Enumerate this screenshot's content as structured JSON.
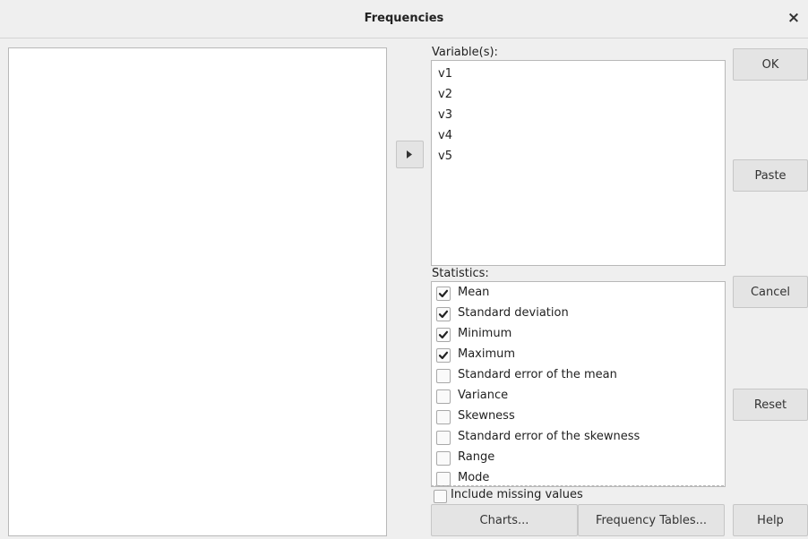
{
  "window": {
    "title": "Frequencies",
    "close_glyph": "×"
  },
  "move_button": {
    "icon": "arrow-right-icon"
  },
  "variables": {
    "label": "Variable(s):",
    "items": [
      "v1",
      "v2",
      "v3",
      "v4",
      "v5"
    ]
  },
  "statistics": {
    "label": "Statistics:",
    "items": [
      {
        "label": "Mean",
        "checked": true
      },
      {
        "label": "Standard deviation",
        "checked": true
      },
      {
        "label": "Minimum",
        "checked": true
      },
      {
        "label": "Maximum",
        "checked": true
      },
      {
        "label": "Standard error of the mean",
        "checked": false
      },
      {
        "label": "Variance",
        "checked": false
      },
      {
        "label": "Skewness",
        "checked": false
      },
      {
        "label": "Standard error of the skewness",
        "checked": false
      },
      {
        "label": "Range",
        "checked": false
      },
      {
        "label": "Mode",
        "checked": false
      }
    ]
  },
  "include_missing": {
    "label": "Include missing values",
    "checked": false
  },
  "buttons": {
    "ok": "OK",
    "paste": "Paste",
    "cancel": "Cancel",
    "reset": "Reset",
    "help": "Help",
    "charts": "Charts...",
    "frequency_tables": "Frequency Tables..."
  }
}
